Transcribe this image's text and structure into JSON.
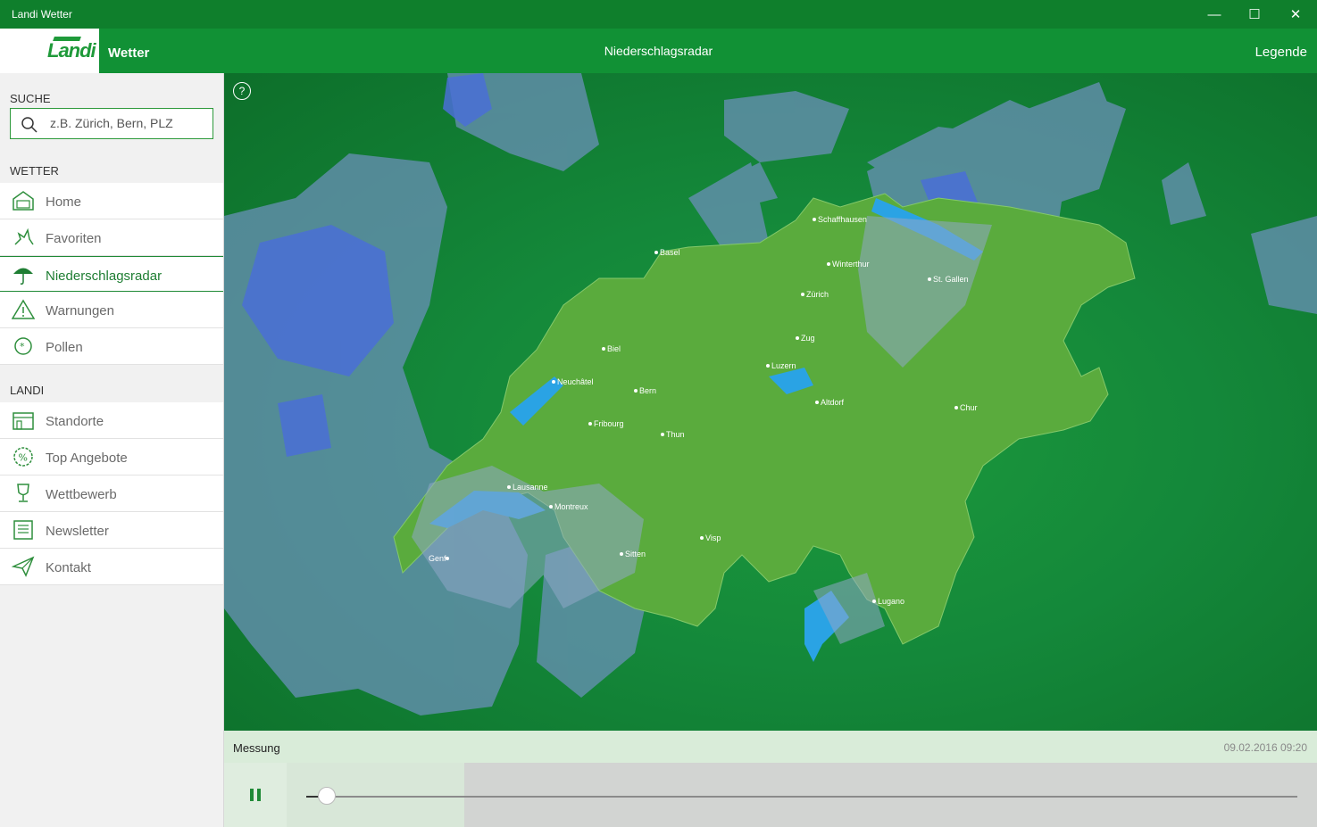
{
  "window": {
    "title": "Landi Wetter",
    "minimize": "—",
    "maximize": "☐",
    "close": "✕"
  },
  "header": {
    "logo_text": "Landi",
    "app_name": "Wetter",
    "page_title": "Niederschlagsradar",
    "legend_link": "Legende"
  },
  "sidebar": {
    "search_label": "SUCHE",
    "search_placeholder": "z.B. Zürich, Bern, PLZ",
    "search_value": "",
    "weather_label": "WETTER",
    "weather_items": [
      {
        "label": "Home",
        "icon": "home-icon"
      },
      {
        "label": "Favoriten",
        "icon": "favorites-icon"
      },
      {
        "label": "Niederschlagsradar",
        "icon": "umbrella-icon",
        "active": true
      },
      {
        "label": "Warnungen",
        "icon": "warning-icon"
      },
      {
        "label": "Pollen",
        "icon": "pollen-icon"
      }
    ],
    "landi_label": "LANDI",
    "landi_items": [
      {
        "label": "Standorte",
        "icon": "store-icon"
      },
      {
        "label": "Top Angebote",
        "icon": "percent-icon"
      },
      {
        "label": "Wettbewerb",
        "icon": "trophy-icon"
      },
      {
        "label": "Newsletter",
        "icon": "newsletter-icon"
      },
      {
        "label": "Kontakt",
        "icon": "paper-plane-icon"
      }
    ]
  },
  "map": {
    "help": "?",
    "cities": [
      "Schaffhausen",
      "Basel",
      "Winterthur",
      "St. Gallen",
      "Zürich",
      "Zug",
      "Biel",
      "Luzern",
      "Neuchâtel",
      "Bern",
      "Altdorf",
      "Chur",
      "Fribourg",
      "Thun",
      "Lausanne",
      "Montreux",
      "Visp",
      "Sitten",
      "Genf",
      "Lugano"
    ]
  },
  "timeline": {
    "label": "Messung",
    "timestamp": "09.02.2016 09:20",
    "progress": 0.02
  },
  "colors": {
    "brand_green": "#119135",
    "titlebar": "#0f7f2c",
    "rain": "#4a6fd6"
  }
}
